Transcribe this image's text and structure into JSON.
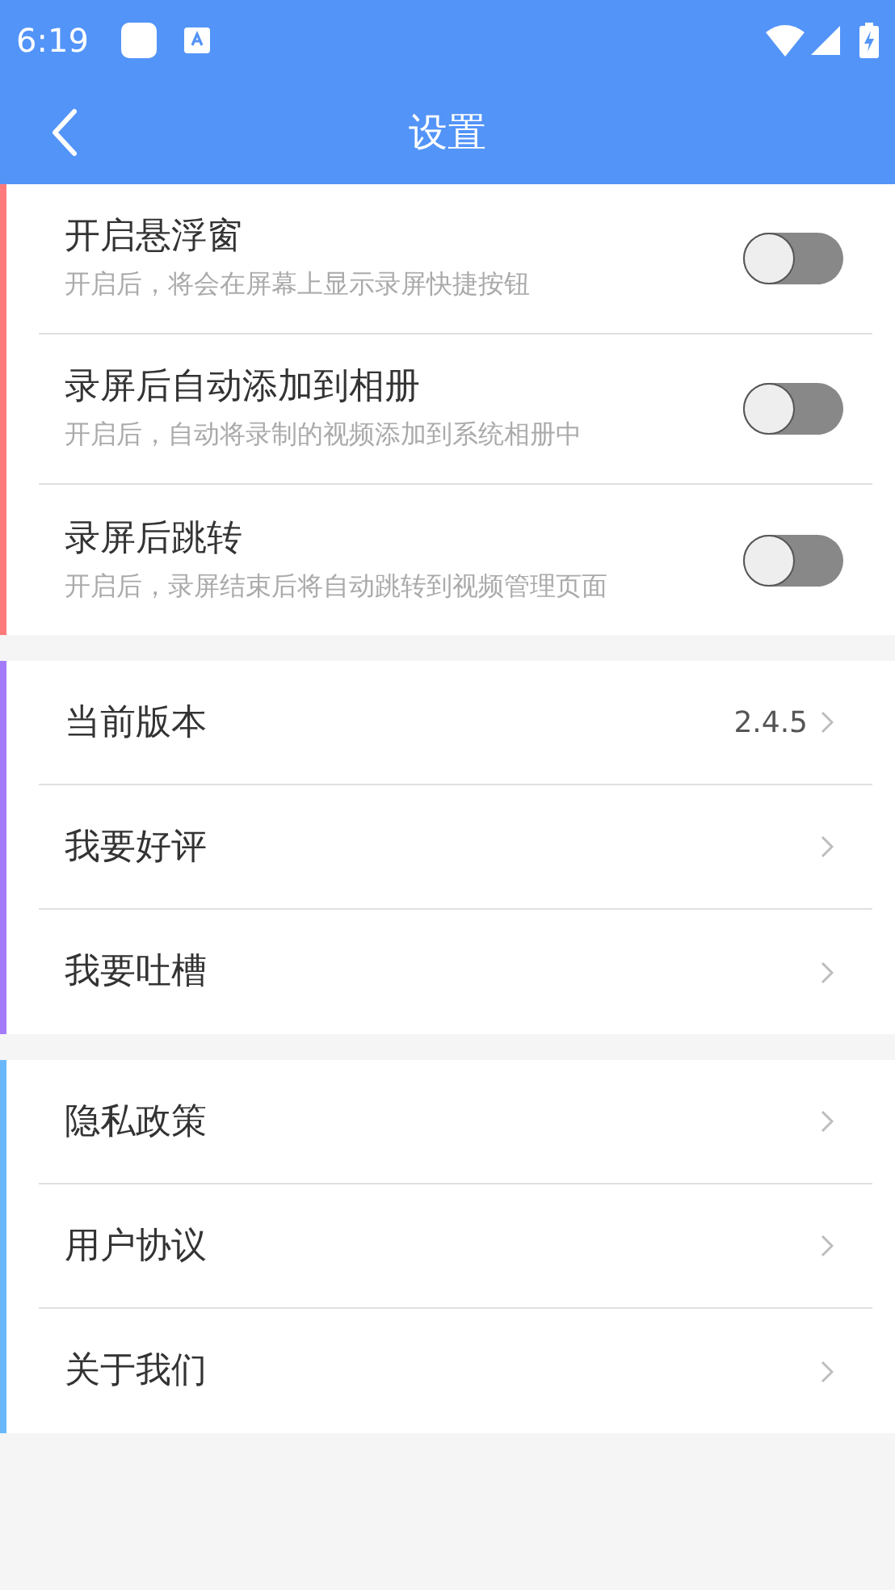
{
  "status_bar": {
    "time": "6:19"
  },
  "app_bar": {
    "title": "设置"
  },
  "sections": [
    {
      "color": "#ff7b7b",
      "items": [
        {
          "kind": "toggle",
          "label": "开启悬浮窗",
          "description": "开启后，将会在屏幕上显示录屏快捷按钮",
          "on": false
        },
        {
          "kind": "toggle",
          "label": "录屏后自动添加到相册",
          "description": "开启后，自动将录制的视频添加到系统相册中",
          "on": false
        },
        {
          "kind": "toggle",
          "label": "录屏后跳转",
          "description": "开启后，录屏结束后将自动跳转到视频管理页面",
          "on": false
        }
      ]
    },
    {
      "color": "#a47cf9",
      "items": [
        {
          "kind": "link",
          "label": "当前版本",
          "value": "2.4.5"
        },
        {
          "kind": "link",
          "label": "我要好评"
        },
        {
          "kind": "link",
          "label": "我要吐槽"
        }
      ]
    },
    {
      "color": "#6ab8fa",
      "items": [
        {
          "kind": "link",
          "label": "隐私政策"
        },
        {
          "kind": "link",
          "label": "用户协议"
        },
        {
          "kind": "link",
          "label": "关于我们"
        }
      ]
    }
  ]
}
